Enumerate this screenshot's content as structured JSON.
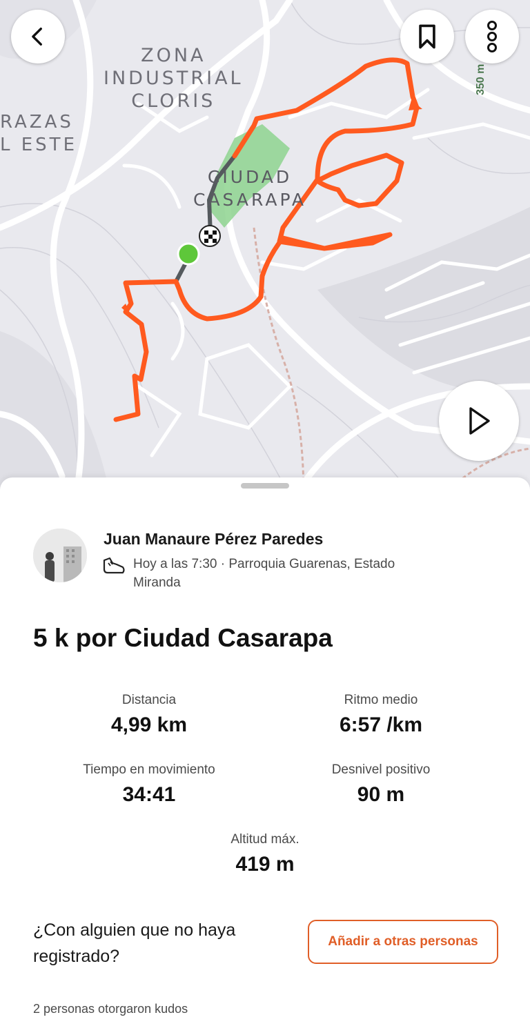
{
  "map": {
    "labels": {
      "zona": "ZONA\nINDUSTRIAL\nCLORIS",
      "razas": "RAZAS\nL ESTE",
      "ciudad": "CIUDAD\nCASARAPA"
    },
    "elevation_label": "350 m",
    "route_color": "#ff5a1f",
    "start_color": "#5ec73a"
  },
  "activity": {
    "athlete_name": "Juan Manaure Pérez Paredes",
    "meta": "Hoy a las 7:30 · Parroquia Guarenas, Estado Miranda",
    "title": "5 k por Ciudad Casarapa",
    "stats": {
      "distance_label": "Distancia",
      "distance_value": "4,99 km",
      "pace_label": "Ritmo medio",
      "pace_value": "6:57 /km",
      "moving_time_label": "Tiempo en movimiento",
      "moving_time_value": "34:41",
      "elevation_gain_label": "Desnivel positivo",
      "elevation_gain_value": "90 m",
      "max_altitude_label": "Altitud máx.",
      "max_altitude_value": "419 m"
    }
  },
  "tag_prompt": "¿Con alguien que no haya registrado?",
  "add_others_button": "Añadir a otras personas",
  "kudos_text": "2 personas otorgaron kudos",
  "icons": {
    "back": "chevron-left-icon",
    "save": "bookmark-icon",
    "more": "more-vertical-icon",
    "play": "play-icon",
    "activity_type": "shoe-icon"
  },
  "colors": {
    "accent": "#e05e27"
  }
}
